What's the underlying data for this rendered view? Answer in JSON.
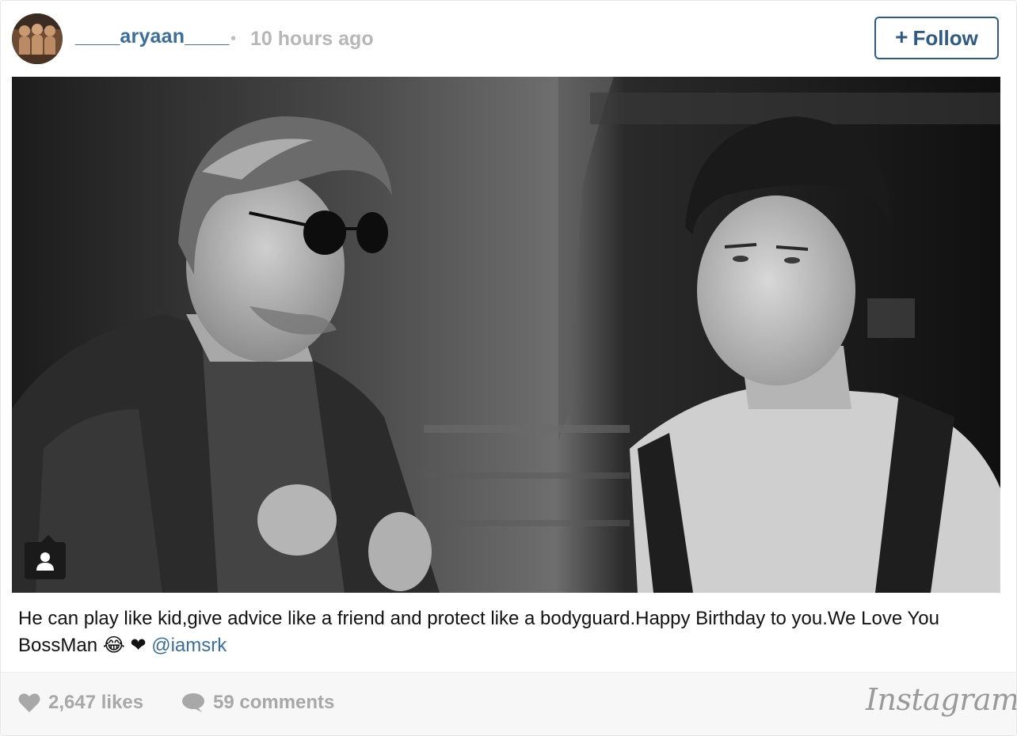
{
  "post": {
    "username": "____aryaan____",
    "separator": "•",
    "time": "10 hours ago",
    "follow_label": "Follow",
    "follow_icon": "+"
  },
  "caption": {
    "text": "He can play like kid,give advice like a friend and protect like a bodyguard.Happy Birthday to you.We Love You BossMan",
    "emoji": "😂",
    "heart": "❤",
    "mention": "@iamsrk"
  },
  "footer": {
    "likes": "2,647 likes",
    "comments": "59 comments",
    "brand": "Instagram"
  },
  "icons": {
    "avatar": "avatar-image",
    "tag": "user-tag-icon",
    "like": "heart-icon",
    "comment": "comment-bubble-icon"
  },
  "colors": {
    "link": "#3b6e9a",
    "follow_border": "#2f5a83",
    "muted": "#a8a8a8"
  }
}
